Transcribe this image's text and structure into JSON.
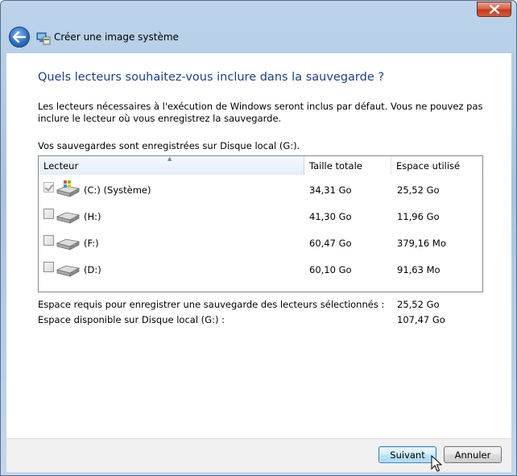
{
  "window": {
    "title": "Créer une image système"
  },
  "page": {
    "heading": "Quels lecteurs souhaitez-vous inclure dans la sauvegarde ?",
    "description": "Les lecteurs nécessaires à l'exécution de Windows seront inclus par défaut. Vous ne pouvez pas inclure le lecteur où vous enregistrez la sauvegarde.",
    "saved_to": "Vos sauvegardes sont enregistrées sur Disque local (G:)."
  },
  "table": {
    "columns": [
      "Lecteur",
      "Taille totale",
      "Espace utilisé"
    ],
    "rows": [
      {
        "name": "(C:) (Système)",
        "total": "34,31 Go",
        "used": "25,52 Go",
        "checked": true,
        "disabled": true,
        "icon": "windows-drive-icon"
      },
      {
        "name": "(H:)",
        "total": "41,30 Go",
        "used": "11,96 Go",
        "checked": false,
        "disabled": false,
        "icon": "hard-drive-icon"
      },
      {
        "name": "(F:)",
        "total": "60,47 Go",
        "used": "379,16 Mo",
        "checked": false,
        "disabled": false,
        "icon": "hard-drive-icon"
      },
      {
        "name": "(D:)",
        "total": "60,10 Go",
        "used": "91,63 Mo",
        "checked": false,
        "disabled": false,
        "icon": "hard-drive-icon"
      }
    ]
  },
  "summary": {
    "required_label": "Espace requis pour enregistrer une sauvegarde des lecteurs sélectionnés :",
    "required_value": "25,52 Go",
    "available_label": "Espace disponible sur Disque local (G:) :",
    "available_value": "107,47 Go"
  },
  "buttons": {
    "next": "Suivant",
    "cancel": "Annuler"
  },
  "colors": {
    "heading": "#1e3f8c",
    "close": "#c4391e",
    "accent": "#3c7fb1"
  }
}
